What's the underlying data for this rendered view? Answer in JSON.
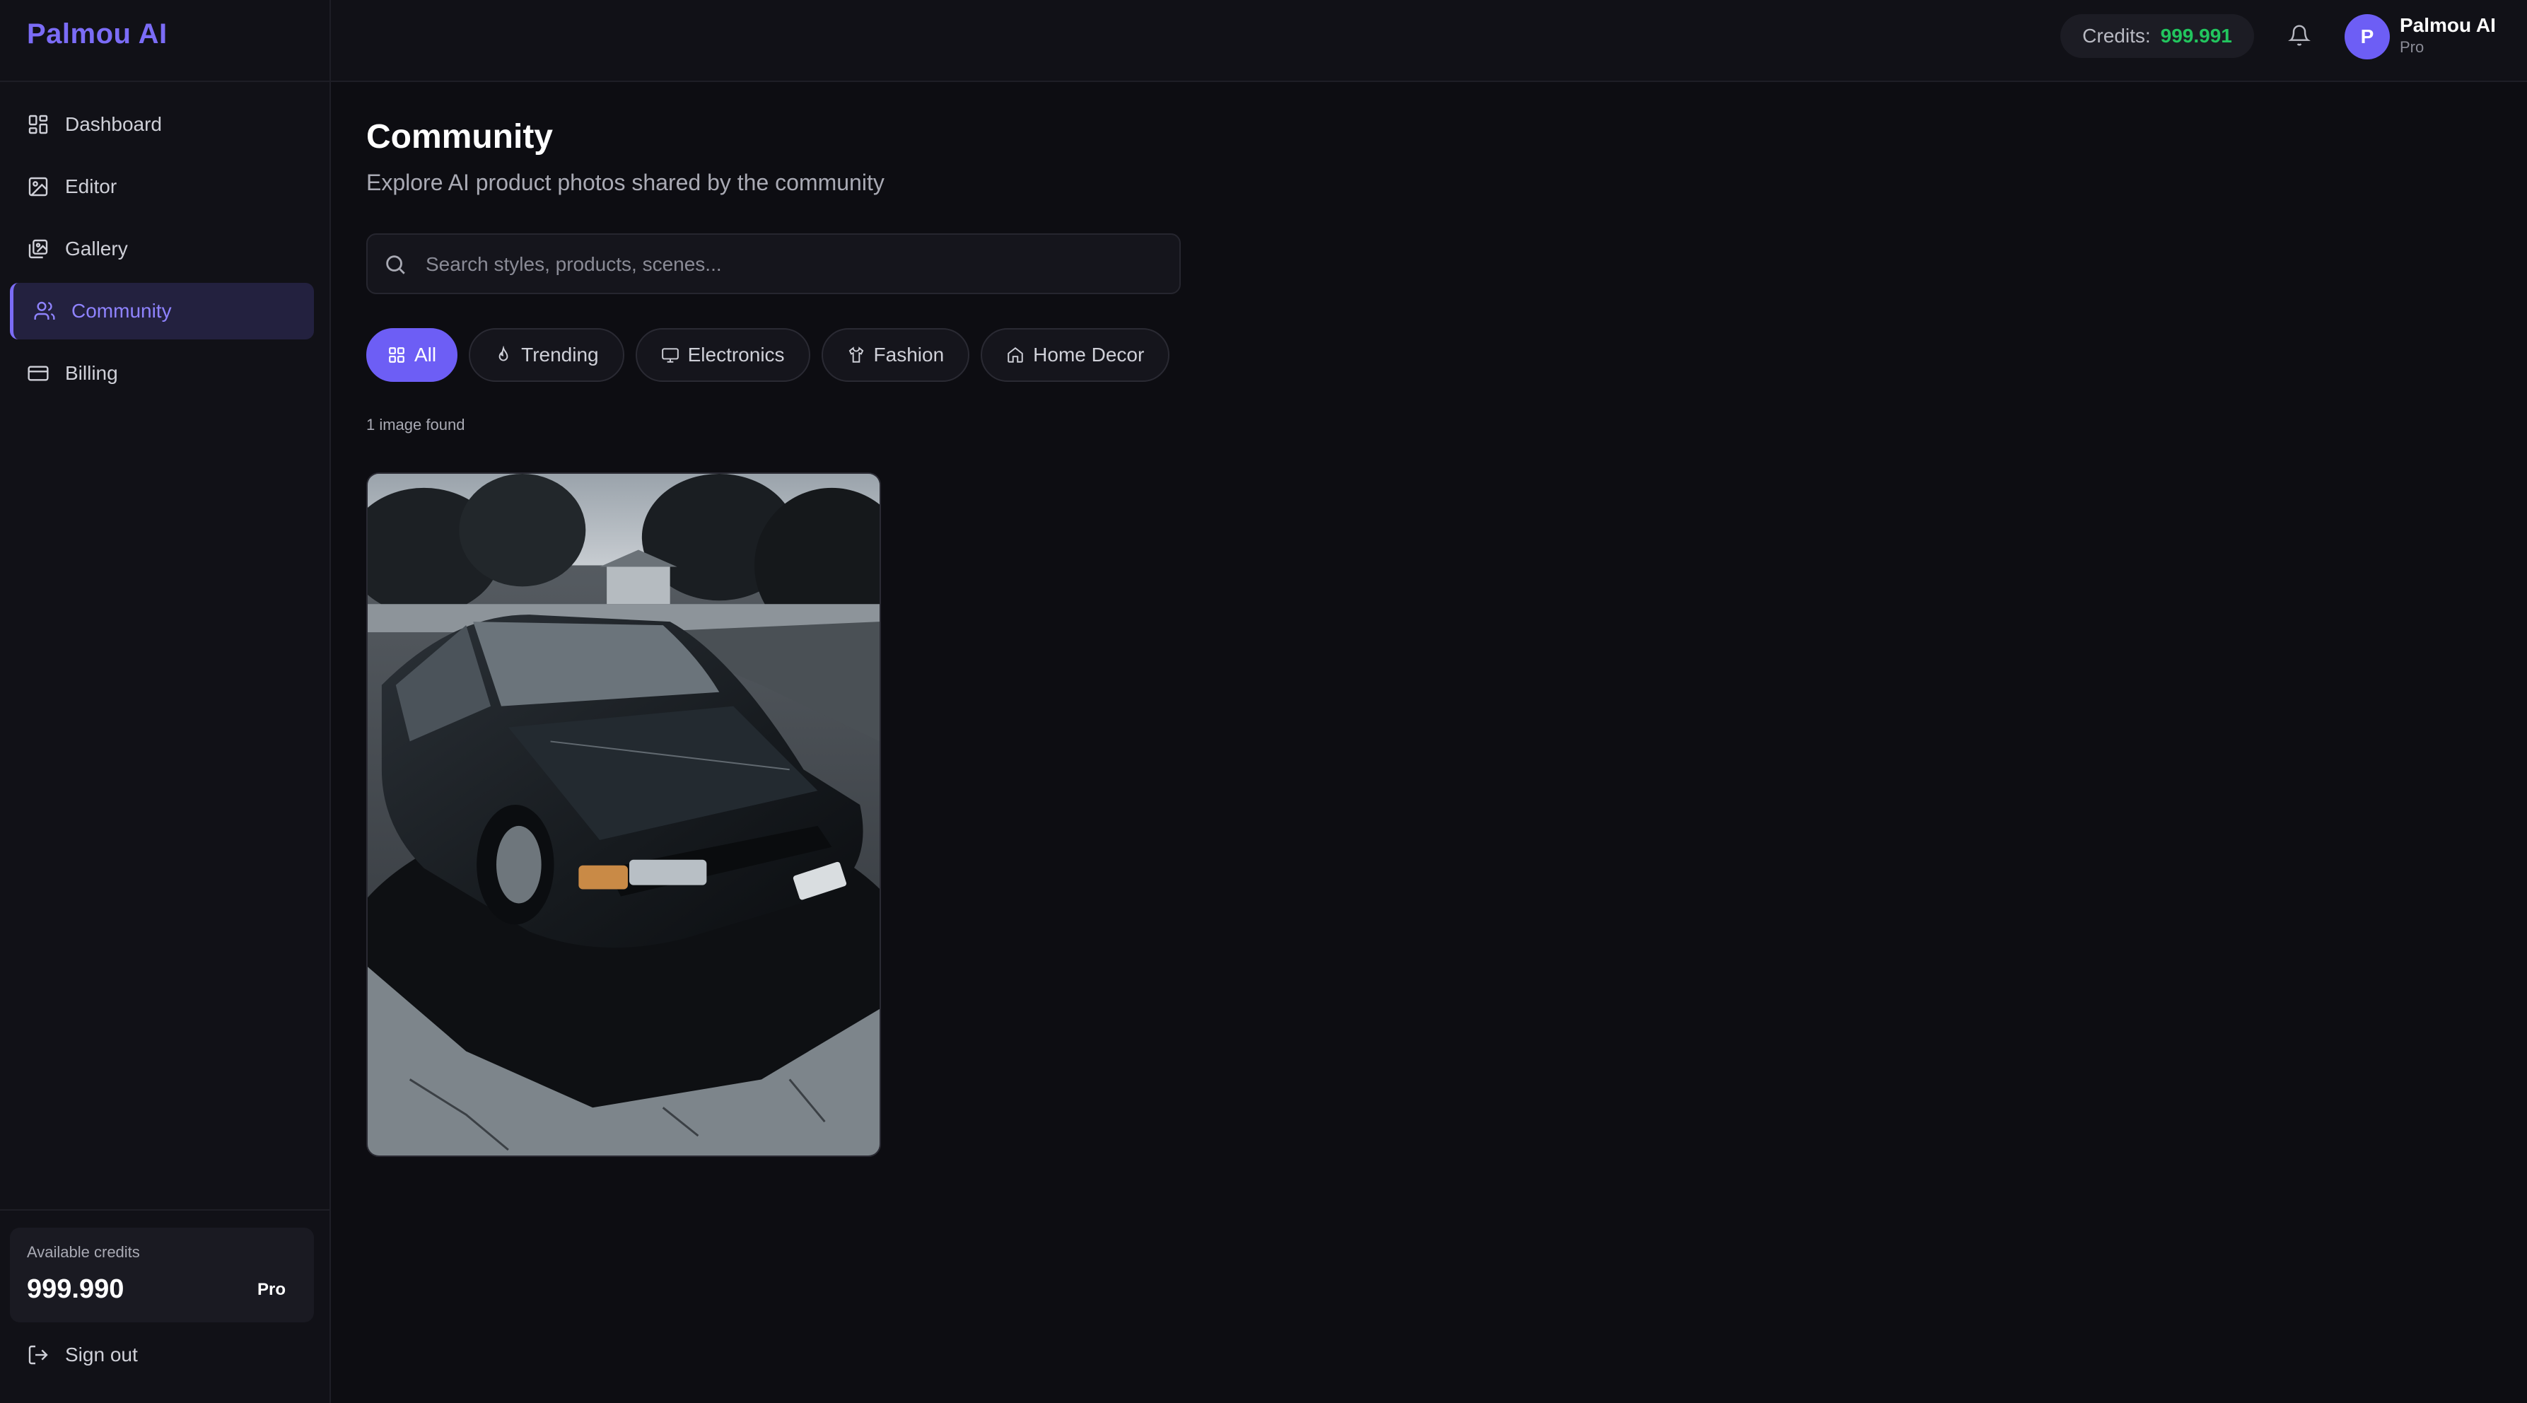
{
  "app": {
    "brand": "Palmou AI"
  },
  "sidebar": {
    "items": [
      {
        "label": "Dashboard",
        "icon": "grid-icon"
      },
      {
        "label": "Editor",
        "icon": "image-icon"
      },
      {
        "label": "Gallery",
        "icon": "images-icon"
      },
      {
        "label": "Community",
        "icon": "users-icon",
        "active": true
      },
      {
        "label": "Billing",
        "icon": "credit-card-icon"
      }
    ],
    "credits": {
      "label": "Available credits",
      "value": "999.990",
      "plan": "Pro"
    },
    "sign_out": "Sign out"
  },
  "header": {
    "credits_label": "Credits:",
    "credits_value": "999.991",
    "user": {
      "initial": "P",
      "name": "Palmou AI",
      "plan": "Pro"
    }
  },
  "main": {
    "title": "Community",
    "subtitle": "Explore AI product photos shared by the community",
    "search": {
      "placeholder": "Search styles, products, scenes..."
    },
    "filters": [
      {
        "label": "All",
        "icon": "grid-icon",
        "active": true
      },
      {
        "label": "Trending",
        "icon": "flame-icon"
      },
      {
        "label": "Electronics",
        "icon": "monitor-icon"
      },
      {
        "label": "Fashion",
        "icon": "shirt-icon"
      },
      {
        "label": "Home Decor",
        "icon": "home-icon"
      }
    ],
    "result_count": "1 image found"
  },
  "colors": {
    "accent": "#6d5ef5",
    "brand": "#7b6cf6",
    "credits_green": "#22c55e",
    "background": "#0d0d12"
  }
}
